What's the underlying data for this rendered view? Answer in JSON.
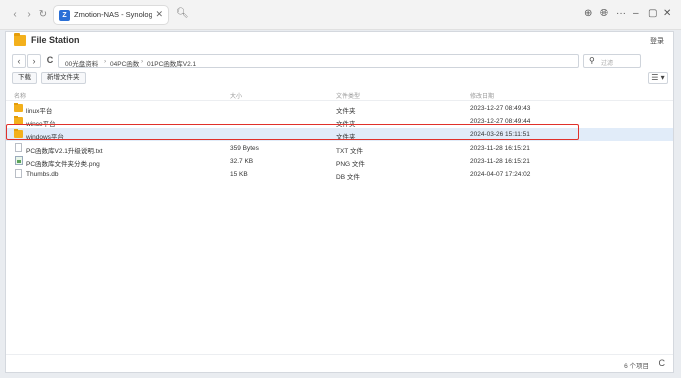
{
  "browser": {
    "back": "‹",
    "forward": "›",
    "reload": "↻",
    "tab_title": "Zmotion-NAS - Synology N",
    "tab_close": "✕",
    "new_tab": "🔍︎",
    "download": "⊕",
    "globe": "🌐︎",
    "more": "···",
    "minimize": "–",
    "restore": "▢",
    "close": "✕"
  },
  "app": {
    "title": "File Station",
    "help": "登录"
  },
  "path": {
    "back": "‹",
    "forward": "›",
    "refresh": "C",
    "crumbs": [
      "00光盘资料",
      "04PC函数",
      "01PC函数库V2.1"
    ],
    "separator": "›",
    "filter_placeholder": "过滤"
  },
  "toolbar": {
    "download_label": "下载",
    "new_folder_label": "新增文件夹",
    "view_icon": "☰ ▾"
  },
  "table": {
    "headers": {
      "name": "名称",
      "size": "大小",
      "type": "文件类型",
      "modified": "修改日期"
    },
    "rows": [
      {
        "name": "linux平台",
        "size": "",
        "type": "文件夹",
        "modified": "2023-12-27 08:49:43",
        "icon": "folder"
      },
      {
        "name": "wince平台",
        "size": "",
        "type": "文件夹",
        "modified": "2023-12-27 08:49:44",
        "icon": "folder"
      },
      {
        "name": "windows平台",
        "size": "",
        "type": "文件夹",
        "modified": "2024-03-26 15:11:51",
        "icon": "folder"
      },
      {
        "name": "PC函数库V2.1升级说明.txt",
        "size": "359 Bytes",
        "type": "TXT 文件",
        "modified": "2023-11-28 16:15:21",
        "icon": "file"
      },
      {
        "name": "PC函数库文件夹分类.png",
        "size": "32.7 KB",
        "type": "PNG 文件",
        "modified": "2023-11-28 16:15:21",
        "icon": "image"
      },
      {
        "name": "Thumbs.db",
        "size": "15 KB",
        "type": "DB 文件",
        "modified": "2024-04-07 17:24:02",
        "icon": "file"
      }
    ]
  },
  "footer": {
    "count": "6 个项目",
    "refresh": "C"
  },
  "colors": {
    "selection": "#e1ecf9",
    "highlight_border": "#e0312b",
    "folder": "#f3b01c"
  }
}
